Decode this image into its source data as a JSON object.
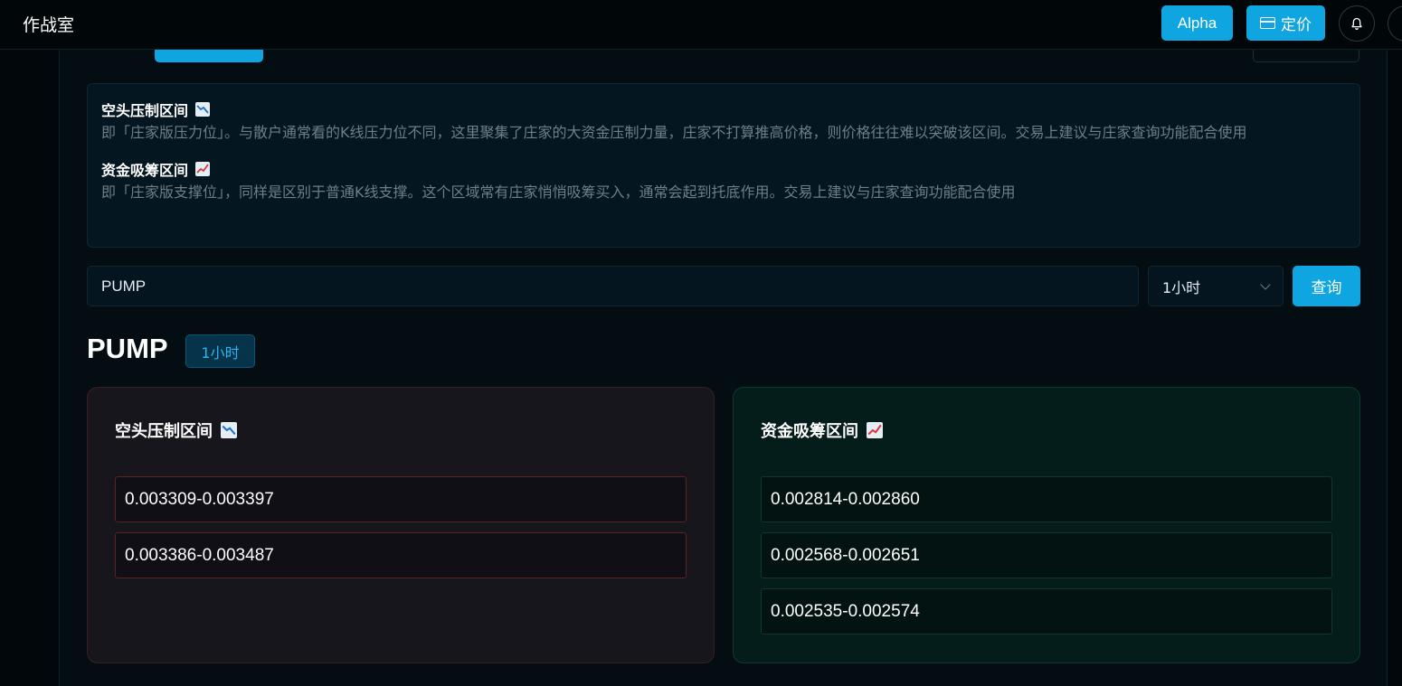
{
  "topbar": {
    "app_title": "作战室",
    "alpha_label": "Alpha",
    "pricing_label": "定价"
  },
  "info": {
    "bear": {
      "title": "空头压制区间",
      "desc": "即「庄家版压力位」。与散户通常看的K线压力位不同，这里聚集了庄家的大资金压制力量，庄家不打算推高价格，则价格往往难以突破该区间。交易上建议与庄家查询功能配合使用"
    },
    "bull": {
      "title": "资金吸筹区间",
      "desc": "即「庄家版支撑位」，同样是区别于普通K线支撑。这个区域常有庄家悄悄吸筹买入，通常会起到托底作用。交易上建议与庄家查询功能配合使用"
    }
  },
  "query": {
    "symbol_value": "PUMP",
    "interval_selected": "1小时",
    "submit_label": "查询"
  },
  "result": {
    "symbol": "PUMP",
    "interval": "1小时",
    "bear_panel": {
      "title": "空头压制区间",
      "ranges": [
        "0.003309-0.003397",
        "0.003386-0.003487"
      ]
    },
    "bull_panel": {
      "title": "资金吸筹区间",
      "ranges": [
        "0.002814-0.002860",
        "0.002568-0.002651",
        "0.002535-0.002574"
      ]
    }
  },
  "colors": {
    "accent": "#0ea5e0",
    "bear_border": "#5a2326",
    "bull_border": "#13352f"
  }
}
